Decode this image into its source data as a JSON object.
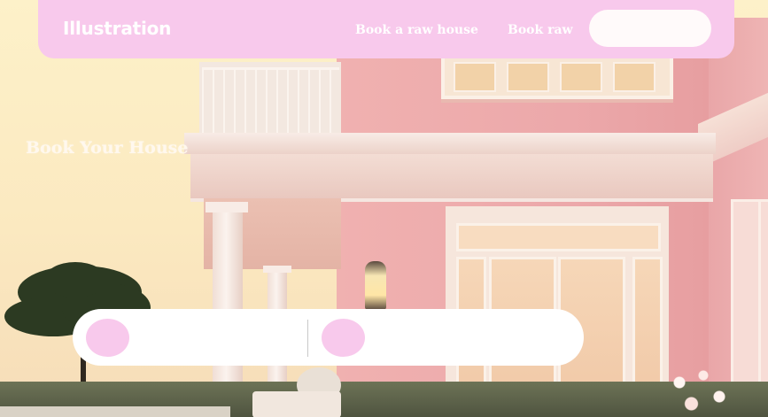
{
  "nav": {
    "brand": "Illustration",
    "links": [
      "Book a raw house",
      "Book raw"
    ],
    "button_label": ""
  },
  "hero": {
    "title": "Book Your House"
  },
  "booking": {
    "fields": [
      "",
      ""
    ]
  },
  "colors": {
    "accent_pink": "#f8c9ec",
    "white": "#ffffff",
    "sky": "#fdf1c9"
  }
}
